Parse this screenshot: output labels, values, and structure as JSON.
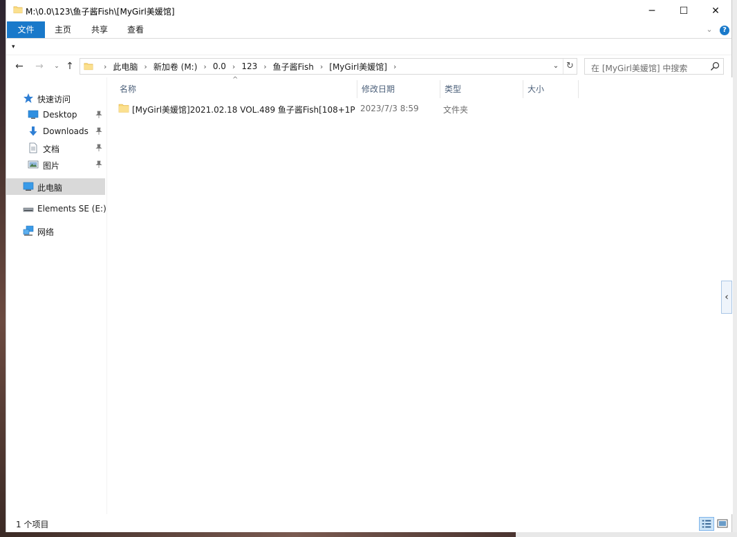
{
  "window": {
    "title": "M:\\0.0\\123\\鱼子酱Fish\\[MyGirl美媛馆]",
    "min_glyph": "─",
    "max_glyph": "☐",
    "close_glyph": "✕"
  },
  "ribbon": {
    "tabs": [
      "文件",
      "主页",
      "共享",
      "查看"
    ],
    "chevron": "⌄",
    "help": "?"
  },
  "qat": {
    "arrow": "▾"
  },
  "nav": {
    "back": "←",
    "forward": "→",
    "recent": "⌄",
    "up": "↑"
  },
  "address": {
    "separator": "›",
    "crumbs": [
      "此电脑",
      "新加卷 (M:)",
      "0.0",
      "123",
      "鱼子酱Fish",
      "[MyGirl美媛馆]"
    ],
    "dropdown": "⌄",
    "refresh": "↻"
  },
  "search": {
    "placeholder": "在 [MyGirl美媛馆] 中搜索"
  },
  "sidebar": {
    "quick_access": "快速访问",
    "items": [
      {
        "label": "Desktop",
        "icon": "desktop-icon"
      },
      {
        "label": "Downloads",
        "icon": "downloads-icon"
      },
      {
        "label": "文档",
        "icon": "documents-icon"
      },
      {
        "label": "图片",
        "icon": "pictures-icon"
      }
    ],
    "this_pc": "此电脑",
    "drive": "Elements SE (E:)",
    "network": "网络"
  },
  "columns": {
    "name": "名称",
    "modified": "修改日期",
    "type": "类型",
    "size": "大小",
    "sort_glyph": "^"
  },
  "files": [
    {
      "name": "[MyGirl美媛馆]2021.02.18 VOL.489 鱼子酱Fish[108+1P",
      "modified": "2023/7/3 8:59",
      "type": "文件夹",
      "size": ""
    }
  ],
  "collapse_glyph": "‹",
  "status": {
    "count": "1 个项目"
  },
  "colors": {
    "accent": "#1979ca",
    "selected": "#d9d9d9",
    "folder": "#f7d26b"
  }
}
